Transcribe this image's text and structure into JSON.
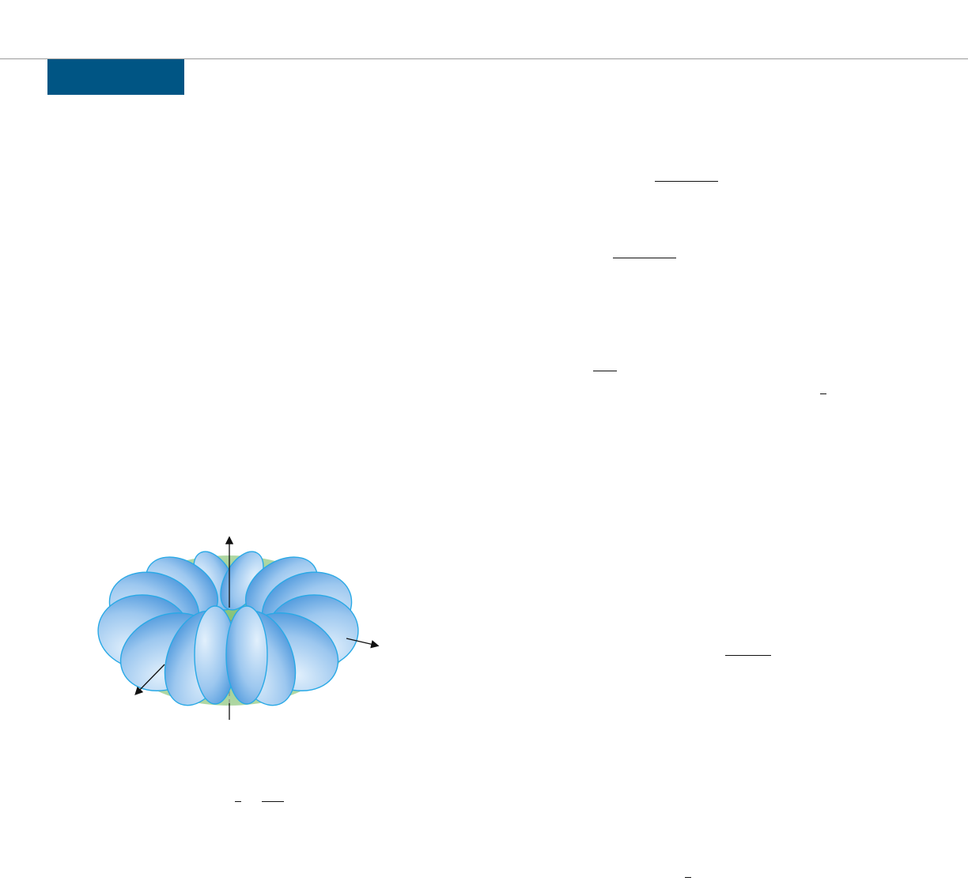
{
  "page": {
    "header_rule_color": "#9a9a9a",
    "section_tab_color": "#005584"
  },
  "figure": {
    "description_icon": "torus-solid-of-revolution",
    "colors": {
      "torus_fill": "#a6cf9a",
      "slice_fill_light": "#d9ecfb",
      "slice_fill_dark": "#2f86d6",
      "slice_stroke": "#29a9e6",
      "axis_color": "#111111",
      "hidden_axis_color": "#8a8a8a"
    }
  }
}
